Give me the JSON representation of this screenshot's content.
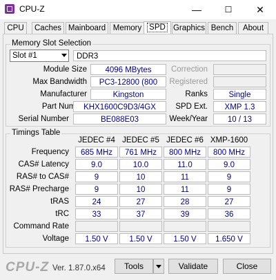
{
  "window": {
    "title": "CPU-Z",
    "minimize": "—",
    "maximize": "☐",
    "close": "✕"
  },
  "tabs": [
    "CPU",
    "Caches",
    "Mainboard",
    "Memory",
    "SPD",
    "Graphics",
    "Bench",
    "About"
  ],
  "active_tab": "SPD",
  "memory_slot": {
    "group_label": "Memory Slot Selection",
    "slot_value": "Slot #1",
    "type": "DDR3",
    "labels": {
      "module_size": "Module Size",
      "max_bandwidth": "Max Bandwidth",
      "manufacturer": "Manufacturer",
      "part_number": "Part Number",
      "serial_number": "Serial Number",
      "correction": "Correction",
      "registered": "Registered",
      "ranks": "Ranks",
      "spd_ext": "SPD Ext.",
      "week_year": "Week/Year"
    },
    "values": {
      "module_size": "4096 MBytes",
      "max_bandwidth": "PC3-12800 (800 MHz)",
      "manufacturer": "Kingston",
      "part_number": "KHX1600C9D3/4GX",
      "serial_number": "BE088E03",
      "correction": "",
      "registered": "",
      "ranks": "Single",
      "spd_ext": "XMP 1.3",
      "week_year": "10 / 13"
    }
  },
  "timings": {
    "group_label": "Timings Table",
    "columns": [
      "JEDEC #4",
      "JEDEC #5",
      "JEDEC #6",
      "XMP-1600"
    ],
    "rows": [
      {
        "label": "Frequency",
        "values": [
          "685 MHz",
          "761 MHz",
          "800 MHz",
          "800 MHz"
        ]
      },
      {
        "label": "CAS# Latency",
        "values": [
          "9.0",
          "10.0",
          "11.0",
          "9.0"
        ]
      },
      {
        "label": "RAS# to CAS#",
        "values": [
          "9",
          "10",
          "11",
          "9"
        ]
      },
      {
        "label": "RAS# Precharge",
        "values": [
          "9",
          "10",
          "11",
          "9"
        ]
      },
      {
        "label": "tRAS",
        "values": [
          "24",
          "27",
          "28",
          "27"
        ]
      },
      {
        "label": "tRC",
        "values": [
          "33",
          "37",
          "39",
          "36"
        ]
      },
      {
        "label": "Command Rate",
        "values": [
          "",
          "",
          "",
          ""
        ]
      },
      {
        "label": "Voltage",
        "values": [
          "1.50 V",
          "1.50 V",
          "1.50 V",
          "1.650 V"
        ]
      }
    ]
  },
  "footer": {
    "brand": "CPU-Z",
    "version": "Ver. 1.87.0.x64",
    "tools_label": "Tools",
    "validate_label": "Validate",
    "close_label": "Close"
  },
  "colors": {
    "value_text": "#00008b",
    "icon_accent": "#7b2fa3"
  }
}
